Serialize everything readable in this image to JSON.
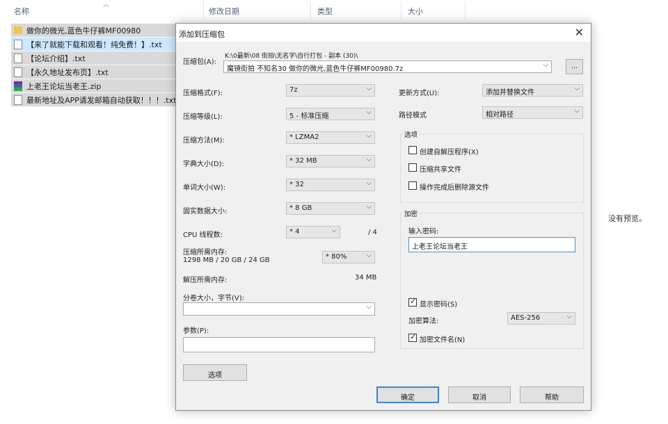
{
  "explorer": {
    "columns": {
      "name": "名称",
      "modified": "修改日期",
      "type": "类型",
      "size": "大小"
    },
    "files": [
      {
        "name": "做你的微光,蓝色牛仔裤MF00980",
        "icon": "folder-icon"
      },
      {
        "name": "【来了就能下载和观看！纯免费！】.txt",
        "icon": "text-file-icon"
      },
      {
        "name": "【论坛介绍】.txt",
        "icon": "text-file-icon"
      },
      {
        "name": "【永久地址发布页】.txt",
        "icon": "text-file-icon"
      },
      {
        "name": "上老王论坛当老王.zip",
        "icon": "winrar-archive-icon"
      },
      {
        "name": "最新地址及APP请发邮箱自动获取！！！.txt",
        "icon": "text-file-icon"
      }
    ],
    "preview_text": "没有预览。"
  },
  "dialog": {
    "title": "添加到压缩包",
    "archive_label": "压缩包(A):",
    "archive_path": "K:\\0最新\\08 街拍\\无名字\\自行打包 - 副本 (30)\\",
    "archive_name": "魔镜街拍 不知名30 做你的微光,蓝色牛仔裤MF00980.7z",
    "browse_label": "...",
    "left": {
      "format_label": "压缩格式(F):",
      "format_value": "7z",
      "level_label": "压缩等级(L):",
      "level_value": "5 - 标准压缩",
      "method_label": "压缩方法(M):",
      "method_value": "* LZMA2",
      "dict_label": "字典大小(D):",
      "dict_value": "* 32 MB",
      "word_label": "单词大小(W):",
      "word_value": "* 32",
      "solid_label": "固实数据大小:",
      "solid_value": "* 8 GB",
      "cpu_label": "CPU 线程数:",
      "cpu_value": "* 4",
      "cpu_total": "/ 4",
      "mem_label": "压缩所需内存:",
      "mem_detail": "1298 MB / 20 GB / 24 GB",
      "mem_value": "* 80%",
      "decomp_label": "解压所需内存:",
      "decomp_value": "34 MB",
      "split_label": "分卷大小，字节(V):",
      "split_value": "",
      "params_label": "参数(P):",
      "params_value": "",
      "options_button": "选项"
    },
    "right": {
      "update_label": "更新方式(U):",
      "update_value": "添加并替换文件",
      "path_label": "路径模式",
      "path_value": "相对路径",
      "options_group": "选项",
      "opt_sfx": {
        "label": "创建自解压程序(X)",
        "checked": false
      },
      "opt_shared": {
        "label": "压缩共享文件",
        "checked": false
      },
      "opt_delete": {
        "label": "操作完成后删除源文件",
        "checked": false
      },
      "encrypt_group": "加密",
      "password_label": "输入密码:",
      "password_value": "上老王论坛当老王",
      "show_password": {
        "label": "显示密码(S)",
        "checked": true
      },
      "enc_method_label": "加密算法:",
      "enc_method_value": "AES-256",
      "encrypt_names": {
        "label": "加密文件名(N)",
        "checked": true
      }
    },
    "buttons": {
      "ok": "确定",
      "cancel": "取消",
      "help": "帮助"
    }
  }
}
